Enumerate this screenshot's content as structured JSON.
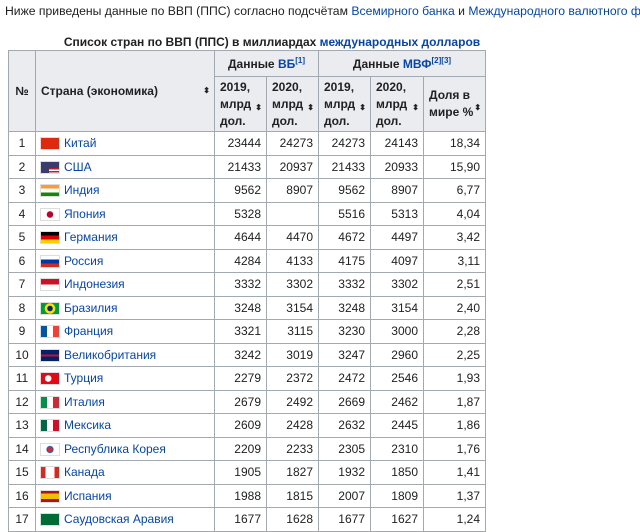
{
  "intro": {
    "text_before": "Ниже приведены данные по ВВП (ППС) согласно подсчётам ",
    "link1": "Всемирного банка",
    "text_mid": " и ",
    "link2": "Международного валютного фонда",
    "text_end": "."
  },
  "caption": {
    "text": "Список стран по ВВП (ППС) в миллиардах ",
    "link": "международных долларов"
  },
  "header": {
    "rank": "№",
    "country": "Страна (экономика)",
    "wb_group": "Данные ",
    "wb_link": "ВБ",
    "wb_ref": "[1]",
    "imf_group": "Данные ",
    "imf_link": "МВФ",
    "imf_ref": "[2][3]",
    "wb_2019": "2019, млрд дол.",
    "wb_2020": "2020, млрд дол.",
    "imf_2019": "2019, млрд дол.",
    "imf_2020": "2020, млрд дол.",
    "share": "Доля в мире %",
    "sort_icon": "⬍"
  },
  "rows": [
    {
      "rank": "1",
      "country": "Китай",
      "flag": "china",
      "wb19": "23444",
      "wb20": "24273",
      "imf19": "24273",
      "imf20": "24143",
      "share": "18,34"
    },
    {
      "rank": "2",
      "country": "США",
      "flag": "usa",
      "wb19": "21433",
      "wb20": "20937",
      "imf19": "21433",
      "imf20": "20933",
      "share": "15,90"
    },
    {
      "rank": "3",
      "country": "Индия",
      "flag": "india",
      "wb19": "9562",
      "wb20": "8907",
      "imf19": "9562",
      "imf20": "8907",
      "share": "6,77"
    },
    {
      "rank": "4",
      "country": "Япония",
      "flag": "japan",
      "wb19": "5328",
      "wb20": "",
      "imf19": "5516",
      "imf20": "5313",
      "share": "4,04"
    },
    {
      "rank": "5",
      "country": "Германия",
      "flag": "germany",
      "wb19": "4644",
      "wb20": "4470",
      "imf19": "4672",
      "imf20": "4497",
      "share": "3,42"
    },
    {
      "rank": "6",
      "country": "Россия",
      "flag": "russia",
      "wb19": "4284",
      "wb20": "4133",
      "imf19": "4175",
      "imf20": "4097",
      "share": "3,11"
    },
    {
      "rank": "7",
      "country": "Индонезия",
      "flag": "indonesia",
      "wb19": "3332",
      "wb20": "3302",
      "imf19": "3332",
      "imf20": "3302",
      "share": "2,51"
    },
    {
      "rank": "8",
      "country": "Бразилия",
      "flag": "brazil",
      "wb19": "3248",
      "wb20": "3154",
      "imf19": "3248",
      "imf20": "3154",
      "share": "2,40"
    },
    {
      "rank": "9",
      "country": "Франция",
      "flag": "france",
      "wb19": "3321",
      "wb20": "3115",
      "imf19": "3230",
      "imf20": "3000",
      "share": "2,28"
    },
    {
      "rank": "10",
      "country": "Великобритания",
      "flag": "uk",
      "wb19": "3242",
      "wb20": "3019",
      "imf19": "3247",
      "imf20": "2960",
      "share": "2,25"
    },
    {
      "rank": "11",
      "country": "Турция",
      "flag": "turkey",
      "wb19": "2279",
      "wb20": "2372",
      "imf19": "2472",
      "imf20": "2546",
      "share": "1,93"
    },
    {
      "rank": "12",
      "country": "Италия",
      "flag": "italy",
      "wb19": "2679",
      "wb20": "2492",
      "imf19": "2669",
      "imf20": "2462",
      "share": "1,87"
    },
    {
      "rank": "13",
      "country": "Мексика",
      "flag": "mexico",
      "wb19": "2609",
      "wb20": "2428",
      "imf19": "2632",
      "imf20": "2445",
      "share": "1,86"
    },
    {
      "rank": "14",
      "country": "Республика Корея",
      "flag": "korea",
      "wb19": "2209",
      "wb20": "2233",
      "imf19": "2305",
      "imf20": "2310",
      "share": "1,76"
    },
    {
      "rank": "15",
      "country": "Канада",
      "flag": "canada",
      "wb19": "1905",
      "wb20": "1827",
      "imf19": "1932",
      "imf20": "1850",
      "share": "1,41"
    },
    {
      "rank": "16",
      "country": "Испания",
      "flag": "spain",
      "wb19": "1988",
      "wb20": "1815",
      "imf19": "2007",
      "imf20": "1809",
      "share": "1,37"
    },
    {
      "rank": "17",
      "country": "Саудовская Аравия",
      "flag": "saudi",
      "wb19": "1677",
      "wb20": "1628",
      "imf19": "1677",
      "imf20": "1627",
      "share": "1,24"
    }
  ]
}
